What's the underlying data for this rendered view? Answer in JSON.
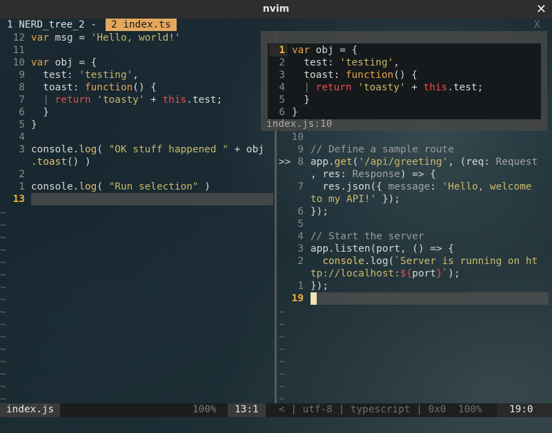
{
  "window": {
    "title": "nvim",
    "close_glyph": "✕"
  },
  "tabline": {
    "tab1": "1 NERD_tree_2 -",
    "tab2": "2 index.ts",
    "close": "X"
  },
  "left_pane": {
    "lines": [
      {
        "n": "12",
        "code": [
          [
            "kw",
            "var"
          ],
          [
            "fn",
            " msg = "
          ],
          [
            "str",
            "'Hello, world!'"
          ]
        ]
      },
      {
        "n": "11",
        "code": []
      },
      {
        "n": "10",
        "code": [
          [
            "kw",
            "var"
          ],
          [
            "fn",
            " obj = {"
          ]
        ]
      },
      {
        "n": "9",
        "code": [
          [
            "fn",
            "  test: "
          ],
          [
            "str",
            "'testing'"
          ],
          [
            "fn",
            ","
          ]
        ]
      },
      {
        "n": "8",
        "code": [
          [
            "fn",
            "  toast: "
          ],
          [
            "kw",
            "function"
          ],
          [
            "fn",
            "() {"
          ]
        ]
      },
      {
        "n": "7",
        "code": [
          [
            "bar",
            "  | "
          ],
          [
            "red",
            "return"
          ],
          [
            "fn",
            " "
          ],
          [
            "str",
            "'toasty'"
          ],
          [
            "fn",
            " + "
          ],
          [
            "red",
            "this"
          ],
          [
            "fn",
            ".test;"
          ]
        ]
      },
      {
        "n": "6",
        "code": [
          [
            "fn",
            "  }"
          ]
        ]
      },
      {
        "n": "5",
        "code": [
          [
            "fn",
            "}"
          ]
        ]
      },
      {
        "n": "4",
        "code": []
      },
      {
        "n": "3",
        "code": [
          [
            "fn",
            "console."
          ],
          [
            "meth",
            "log"
          ],
          [
            "fn",
            "( "
          ],
          [
            "str",
            "\"OK stuff happened \""
          ],
          [
            "fn",
            " + obj"
          ]
        ]
      },
      {
        "n": "",
        "code": [
          [
            "meth",
            ".toast"
          ],
          [
            "fn",
            "() )"
          ]
        ]
      },
      {
        "n": "2",
        "code": []
      },
      {
        "n": "1",
        "code": [
          [
            "fn",
            "console."
          ],
          [
            "meth",
            "log"
          ],
          [
            "fn",
            "( "
          ],
          [
            "str",
            "\"Run selection\""
          ],
          [
            "fn",
            " )"
          ]
        ]
      },
      {
        "n": "13",
        "cur": true,
        "code": []
      }
    ],
    "tilde": "~"
  },
  "popup": {
    "lines": [
      {
        "n": "1",
        "cur": true,
        "code": [
          [
            "kw",
            "var"
          ],
          [
            "fn",
            " obj = {"
          ]
        ]
      },
      {
        "n": "2",
        "code": [
          [
            "fn",
            "  test: "
          ],
          [
            "str",
            "'testing'"
          ],
          [
            "fn",
            ","
          ]
        ]
      },
      {
        "n": "3",
        "code": [
          [
            "fn",
            "  toast: "
          ],
          [
            "kw",
            "function"
          ],
          [
            "fn",
            "() {"
          ]
        ]
      },
      {
        "n": "4",
        "code": [
          [
            "bar",
            "  | "
          ],
          [
            "red",
            "return"
          ],
          [
            "fn",
            " "
          ],
          [
            "str",
            "'toasty'"
          ],
          [
            "fn",
            " + "
          ],
          [
            "red",
            "this"
          ],
          [
            "fn",
            ".test;"
          ]
        ]
      },
      {
        "n": "5",
        "code": [
          [
            "fn",
            "  }"
          ]
        ]
      },
      {
        "n": "6",
        "code": [
          [
            "fn",
            "}"
          ]
        ]
      }
    ],
    "footer": "index.js:10"
  },
  "right_pane": {
    "lines": [
      {
        "n": "10",
        "code": []
      },
      {
        "n": "9",
        "code": [
          [
            "cm",
            "// Define a sample route"
          ]
        ]
      },
      {
        "n": "8",
        "sign": ">>",
        "code": [
          [
            "fn",
            "app."
          ],
          [
            "meth",
            "get"
          ],
          [
            "fn",
            "("
          ],
          [
            "str",
            "'/api/greeting'"
          ],
          [
            "fn",
            ", (req: "
          ],
          [
            "gray",
            "Request"
          ]
        ]
      },
      {
        "n": "",
        "code": [
          [
            "fn",
            ", res: "
          ],
          [
            "gray",
            "Response"
          ],
          [
            "fn",
            ") => {"
          ]
        ]
      },
      {
        "n": "7",
        "code": [
          [
            "fn",
            "  res.json({ "
          ],
          [
            "gray",
            "message"
          ],
          [
            "fn",
            ": "
          ],
          [
            "str",
            "'Hello, welcome"
          ]
        ]
      },
      {
        "n": "",
        "code": [
          [
            "str",
            "to my API!'"
          ],
          [
            "fn",
            " });"
          ]
        ]
      },
      {
        "n": "6",
        "code": [
          [
            "fn",
            "});"
          ]
        ]
      },
      {
        "n": "5",
        "code": []
      },
      {
        "n": "4",
        "code": [
          [
            "cm",
            "// Start the server"
          ]
        ]
      },
      {
        "n": "3",
        "code": [
          [
            "fn",
            "app.listen(port, () => {"
          ]
        ]
      },
      {
        "n": "2",
        "code": [
          [
            "fn",
            "  "
          ],
          [
            "meth",
            "console"
          ],
          [
            "fn",
            ".log("
          ],
          [
            "str",
            "`Server is running on ht"
          ]
        ]
      },
      {
        "n": "",
        "code": [
          [
            "str",
            "tp://localhost:"
          ],
          [
            "red",
            "${"
          ],
          [
            "fn",
            "port"
          ],
          [
            "red",
            "}"
          ],
          [
            "str",
            "`"
          ],
          [
            "fn",
            ");"
          ]
        ]
      },
      {
        "n": "1",
        "code": [
          [
            "fn",
            "});"
          ]
        ]
      },
      {
        "n": "19",
        "cur": true,
        "code": []
      }
    ],
    "tilde": "~"
  },
  "status_left": {
    "file": "index.js",
    "percent": "100%",
    "pos": "13:1"
  },
  "status_right": {
    "info": "< | utf-8 | typescript | 0x0  100%",
    "pos": "19:0"
  },
  "colors": {
    "accent": "#e4a85c",
    "keyword": "#e5a24e",
    "string": "#c9b96b",
    "return": "#e35050"
  }
}
